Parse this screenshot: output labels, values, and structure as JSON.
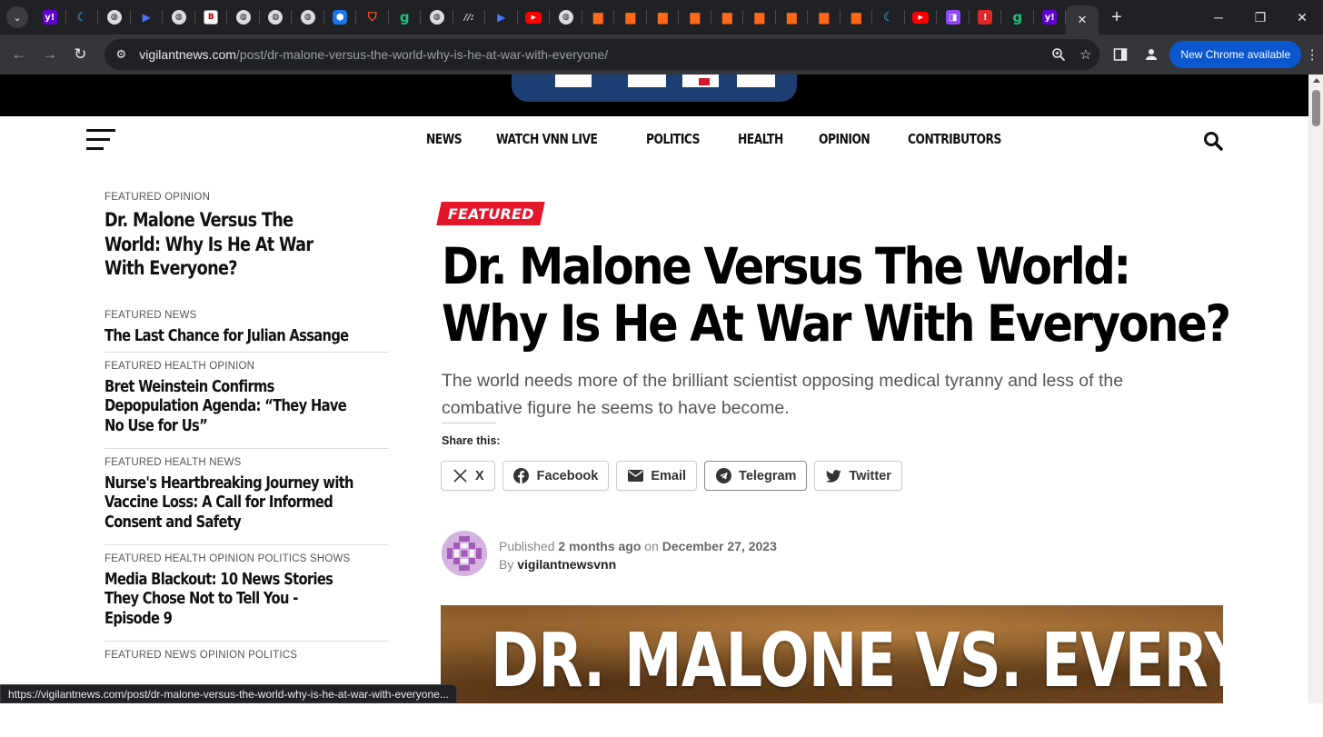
{
  "browser": {
    "pinned_tabs": [
      {
        "icon": "yahoo-icon",
        "glyph": "y!"
      },
      {
        "icon": "moon-icon",
        "glyph": "☾"
      },
      {
        "icon": "globe-icon",
        "glyph": "◍"
      },
      {
        "icon": "play-icon",
        "glyph": "▶"
      },
      {
        "icon": "globe-icon",
        "glyph": "◍"
      },
      {
        "icon": "br-icon",
        "glyph": "B"
      },
      {
        "icon": "globe-icon",
        "glyph": "◍"
      },
      {
        "icon": "globe-icon",
        "glyph": "◍"
      },
      {
        "icon": "globe-icon",
        "glyph": "◍"
      },
      {
        "icon": "hex-icon",
        "glyph": "⬢"
      },
      {
        "icon": "shield-icon",
        "glyph": "⛉"
      },
      {
        "icon": "gettr-icon",
        "glyph": "g"
      },
      {
        "icon": "globe-icon",
        "glyph": "◍"
      },
      {
        "icon": "slash-icon",
        "glyph": "//:"
      },
      {
        "icon": "play-icon",
        "glyph": "▶"
      },
      {
        "icon": "youtube-icon",
        "glyph": "▶"
      },
      {
        "icon": "globe-icon",
        "glyph": "◍"
      },
      {
        "icon": "substack-icon",
        "glyph": "▆"
      },
      {
        "icon": "substack-icon",
        "glyph": "▆"
      },
      {
        "icon": "substack-icon",
        "glyph": "▆"
      },
      {
        "icon": "substack-icon",
        "glyph": "▆"
      },
      {
        "icon": "substack-icon",
        "glyph": "▆"
      },
      {
        "icon": "substack-icon",
        "glyph": "▆"
      },
      {
        "icon": "substack-icon",
        "glyph": "▆"
      },
      {
        "icon": "substack-icon",
        "glyph": "▆"
      },
      {
        "icon": "substack-icon",
        "glyph": "▆"
      },
      {
        "icon": "moon-icon",
        "glyph": "☾"
      },
      {
        "icon": "youtube-icon",
        "glyph": "▶"
      },
      {
        "icon": "twitch-icon",
        "glyph": "◨"
      },
      {
        "icon": "red-icon",
        "glyph": "!"
      },
      {
        "icon": "gettr-icon",
        "glyph": "g"
      },
      {
        "icon": "yahoo-icon",
        "glyph": "y!"
      }
    ],
    "url_host": "vigilantnews.com",
    "url_path": "/post/dr-malone-versus-the-world-why-is-he-at-war-with-everyone/",
    "update_label": "New Chrome available",
    "status_url": "https://vigilantnews.com/post/dr-malone-versus-the-world-why-is-he-at-war-with-everyone..."
  },
  "nav": {
    "links": [
      "NEWS",
      "WATCH VNN LIVE",
      "POLITICS",
      "HEALTH",
      "OPINION",
      "CONTRIBUTORS"
    ]
  },
  "sidebar": {
    "first": {
      "category": "FEATURED OPINION",
      "title": "Dr. Malone Versus The World: Why Is He At War With Everyone?"
    },
    "items": [
      {
        "category": "FEATURED NEWS",
        "title": "The Last Chance for Julian Assange"
      },
      {
        "category": "FEATURED HEALTH OPINION",
        "title": "Bret Weinstein Confirms Depopulation Agenda: “They Have No Use for Us”"
      },
      {
        "category": "FEATURED HEALTH NEWS",
        "title": "Nurse's Heartbreaking Journey with Vaccine Loss: A Call for Informed Consent and Safety"
      },
      {
        "category": "FEATURED HEALTH OPINION POLITICS SHOWS",
        "title": "Media Blackout: 10 News Stories They Chose Not to Tell You - Episode 9"
      },
      {
        "category": "FEATURED NEWS OPINION POLITICS",
        "title": ""
      }
    ]
  },
  "article": {
    "badge": "FEATURED",
    "headline": "Dr. Malone Versus The World: Why Is He At War With Everyone?",
    "dek": "The world needs more of the brilliant scientist opposing medical tyranny and less of the combative figure he seems to have become.",
    "share_label": "Share this:",
    "share_buttons": [
      {
        "name": "x",
        "label": "X"
      },
      {
        "name": "facebook",
        "label": "Facebook"
      },
      {
        "name": "email",
        "label": "Email"
      },
      {
        "name": "telegram",
        "label": "Telegram"
      },
      {
        "name": "twitter",
        "label": "Twitter"
      }
    ],
    "published_prefix": "Published",
    "published_relative": "2 months ago",
    "published_on": "on",
    "published_date": "December 27, 2023",
    "by_prefix": "By",
    "author": "vigilantnewsvnn",
    "hero_text": "DR. MALONE VS. EVERYONE"
  },
  "colors": {
    "badge_red": "#e4162a",
    "logo_blue": "#1e3f73",
    "chrome_dark": "#202124",
    "update_blue": "#0b57d0"
  }
}
